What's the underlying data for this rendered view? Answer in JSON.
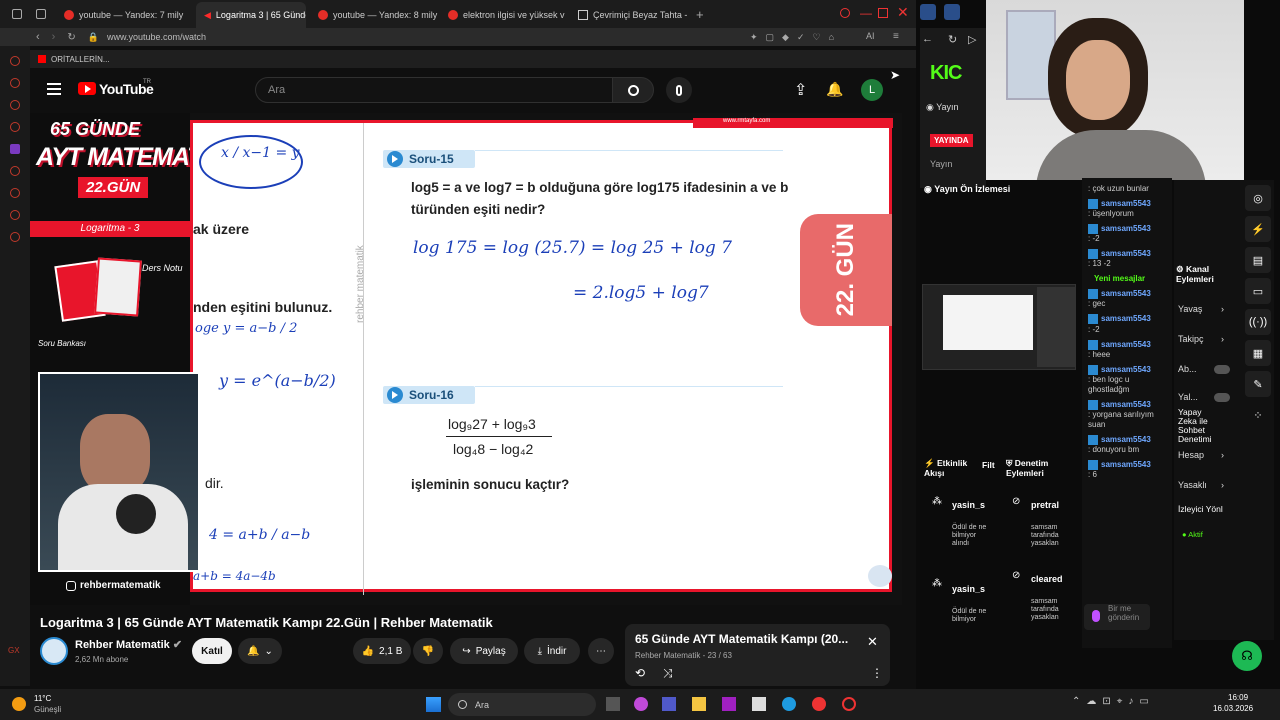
{
  "browser": {
    "tabs": [
      {
        "label": "youtube — Yandex: 7 mily"
      },
      {
        "label": "Logaritma 3 | 65 Günde"
      },
      {
        "label": "youtube — Yandex: 8 mily"
      },
      {
        "label": "elektron ilgisi ve yüksek v"
      },
      {
        "label": "Çevrimiçi Beyaz Tahta - Ç"
      }
    ],
    "url": "www.youtube.com/watch",
    "bookmark": "ORİTALLERİN..."
  },
  "youtube": {
    "logo": "YouTube",
    "region": "TR",
    "search_placeholder": "Ara",
    "avatar_letter": "L"
  },
  "video": {
    "left_panel": {
      "days": "65 GÜNDE",
      "subject": "AYT MATEMATİK",
      "day": "22.GÜN",
      "topic": "Logaritma - 3",
      "notes": "Ders Notu",
      "bank": "Soru Bankası",
      "instagram": "rehbermatematik"
    },
    "board": {
      "site": "www.rmtayfa.com",
      "watermark": "rehber matematik",
      "left_texts": [
        "ak üzere",
        "nden eşitini bulunuz.",
        "dir."
      ],
      "left_hand": [
        "x / x−1 = y",
        "oge y = a−b / 2",
        "y = e^(a−b/2)",
        "4 = a+b / a−b",
        "a+b = 4a−4b"
      ],
      "soru15_label": "Soru-15",
      "soru15_text": "log5 = a ve log7 = b olduğuna göre log175 ifadesinin a ve b türünden eşiti nedir?",
      "soru15_hand1": "log 175 = log (25.7) = log 25 + log 7",
      "soru15_hand2": "= 2.log5 + log7",
      "soru16_label": "Soru-16",
      "soru16_num": "log₉27 + log₉3",
      "soru16_den": "log₄8 − log₄2",
      "soru16_text": "işleminin sonucu kaçtır?",
      "day_tab": "22. GÜN"
    }
  },
  "below": {
    "title": "Logaritma 3 | 65 Günde AYT Matematik Kampı 22.Gün | Rehber Matematik",
    "channel": "Rehber Matematik",
    "subs": "2,62 Mn abone",
    "join": "Katıl",
    "likes": "2,1 B",
    "share": "Paylaş",
    "download": "İndir",
    "playlist_title": "65 Günde AYT Matematik Kampı (20...",
    "playlist_meta": "Rehber Matematik - 23 / 63"
  },
  "taskbar": {
    "weather_temp": "11°C",
    "weather_desc": "Güneşli",
    "search": "Ara",
    "time": "16:09",
    "date": "16.03.2026"
  },
  "kick": {
    "brand": "KIC",
    "yayin": "Yayın",
    "live_badge": "YAYINDA",
    "yayin2": "Yayın",
    "preview_title": "Yayın Ön İzlemesi",
    "chat": [
      {
        "name": "",
        "msg": ": çok uzun bunlar"
      },
      {
        "name": "samsam5543",
        "msg": ": üşenlyorum"
      },
      {
        "name": "samsam5543",
        "msg": ": -2"
      },
      {
        "name": "samsam5543",
        "msg": ": 13 -2"
      },
      {
        "name": "",
        "msg": "Yeni mesajlar"
      },
      {
        "name": "samsam5543",
        "msg": ": gec"
      },
      {
        "name": "samsam5543",
        "msg": ": -2"
      },
      {
        "name": "samsam5543",
        "msg": ": heee"
      },
      {
        "name": "samsam5543",
        "msg": ": ben logc u ghostladğm"
      },
      {
        "name": "samsam5543",
        "msg": ": yorgana sarılıyım suan"
      },
      {
        "name": "samsam5543",
        "msg": ": donuyoru bm"
      },
      {
        "name": "samsam5543",
        "msg": ": 6"
      }
    ],
    "chat_placeholder": "Bir me gönderin",
    "channel_actions_title": "Kanal Eylemleri",
    "channel_actions": [
      "Yavaş",
      "Takipç",
      "Ab...",
      "Yal...",
      "Yapay Zeka ile Sohbet Denetimi",
      "Hesap",
      "Yasaklı",
      "İzleyici Yönl"
    ],
    "aktif": "Aktif",
    "activity_title": "Etkinlik Akışı",
    "filter": "Filt",
    "activity": [
      {
        "name": "yasin_s",
        "desc": "Ödül de ne bilmiyor alındı"
      },
      {
        "name": "yasin_s",
        "desc": "Ödül de ne bilmiyor"
      }
    ],
    "audit_title": "Denetim Eylemleri",
    "audit": [
      {
        "name": "pretral",
        "desc": "samsam tarafında yasaklan"
      },
      {
        "name": "cleared",
        "desc": "samsam tarafında yasaklan"
      }
    ]
  },
  "colors": {
    "accent_red": "#e8152b",
    "kick_green": "#53fc18",
    "yt_red": "#ff0000"
  }
}
